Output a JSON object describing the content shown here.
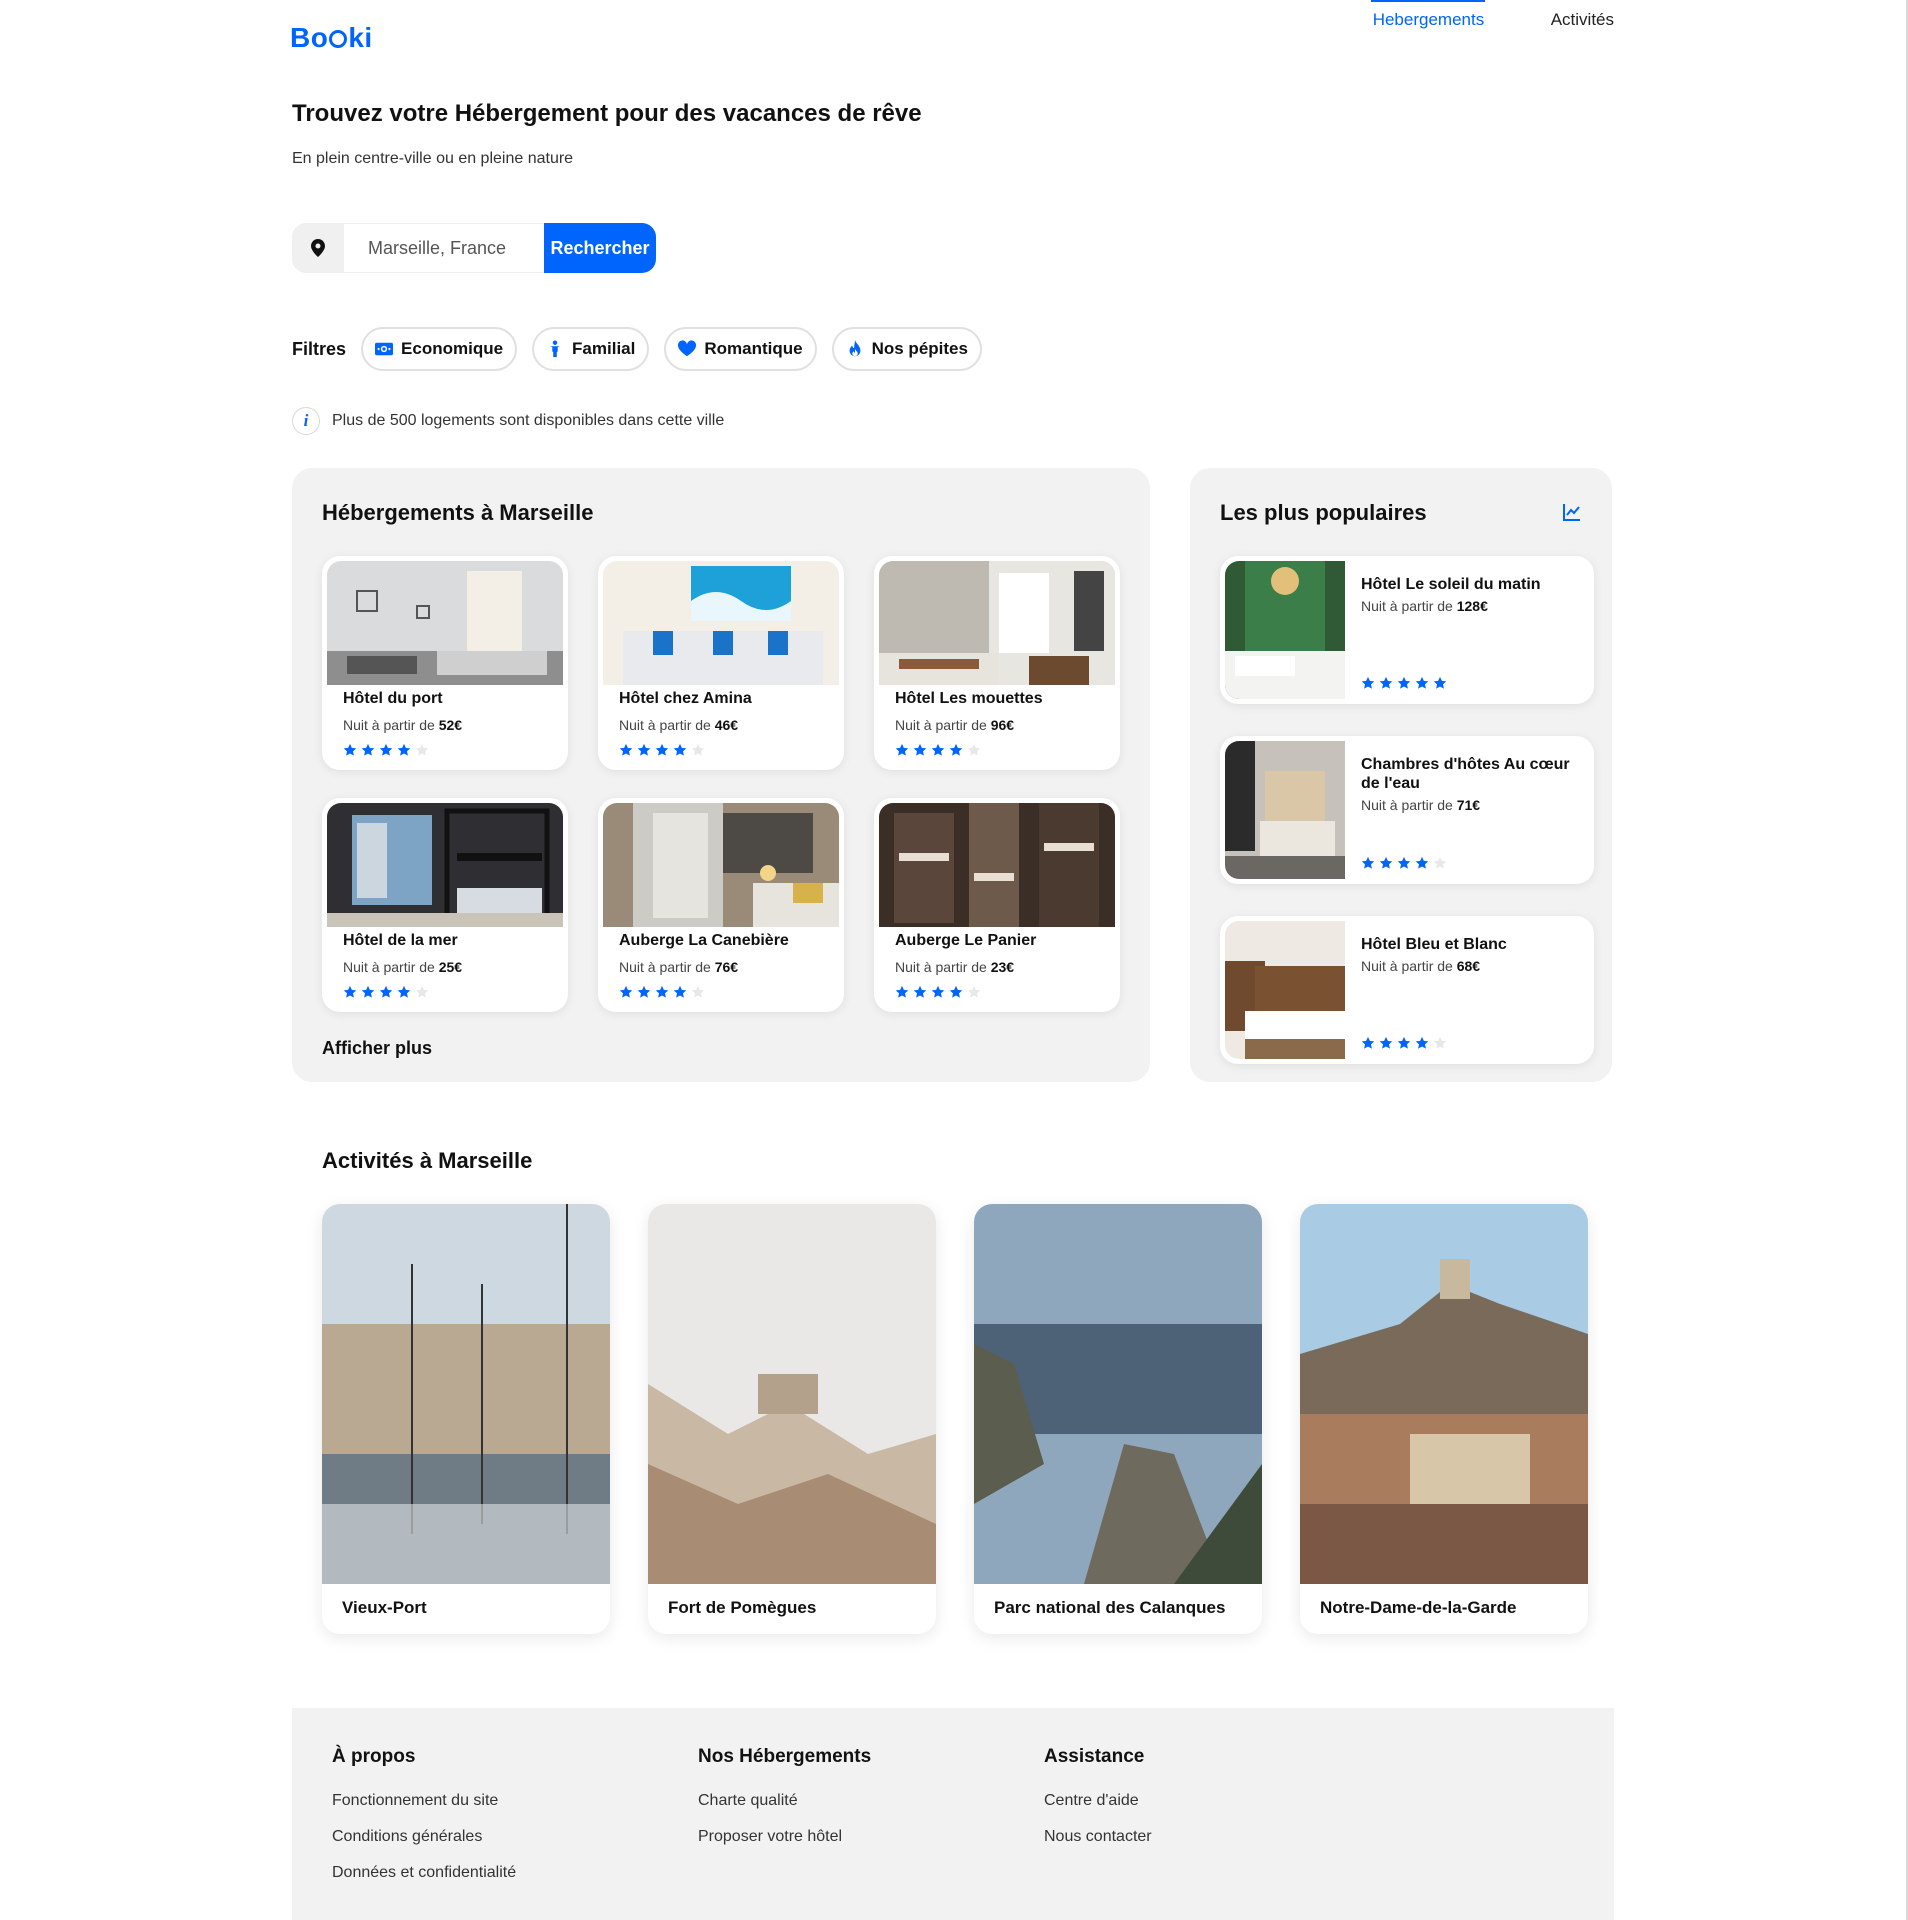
{
  "header": {
    "logo_prefix": "Bo",
    "logo_suffix": "ki",
    "nav": [
      {
        "label": "Hebergements",
        "active": true
      },
      {
        "label": "Activités",
        "active": false
      }
    ]
  },
  "hero": {
    "title": "Trouvez votre Hébergement pour des vacances de rêve",
    "subtitle": "En plein centre-ville ou en pleine nature"
  },
  "search": {
    "value": "Marseille, France",
    "button_label": "Rechercher"
  },
  "filters": {
    "label": "Filtres",
    "chips": [
      {
        "label": "Economique",
        "icon": "money-icon"
      },
      {
        "label": "Familial",
        "icon": "child-icon"
      },
      {
        "label": "Romantique",
        "icon": "heart-icon"
      },
      {
        "label": "Nos pépites",
        "icon": "fire-icon"
      }
    ]
  },
  "info": {
    "text": "Plus de 500 logements sont disponibles dans cette ville"
  },
  "hebergements": {
    "title": "Hébergements à Marseille",
    "price_prefix": "Nuit à partir de ",
    "hotels": [
      {
        "name": "Hôtel du port",
        "price": "52€",
        "rating": 4
      },
      {
        "name": "Hôtel chez Amina",
        "price": "46€",
        "rating": 4
      },
      {
        "name": "Hôtel Les mouettes",
        "price": "96€",
        "rating": 4
      },
      {
        "name": "Hôtel de la mer",
        "price": "25€",
        "rating": 4
      },
      {
        "name": "Auberge La Canebière",
        "price": "76€",
        "rating": 4
      },
      {
        "name": "Auberge Le Panier",
        "price": "23€",
        "rating": 4
      }
    ],
    "show_more": "Afficher plus"
  },
  "populaires": {
    "title": "Les plus populaires",
    "price_prefix": "Nuit à partir de ",
    "items": [
      {
        "name": "Hôtel Le soleil du matin",
        "price": "128€",
        "rating": 5
      },
      {
        "name": "Chambres d'hôtes Au cœur de l'eau",
        "price": "71€",
        "rating": 4
      },
      {
        "name": "Hôtel Bleu et Blanc",
        "price": "68€",
        "rating": 4
      }
    ]
  },
  "activites": {
    "title": "Activités à Marseille",
    "items": [
      {
        "name": "Vieux-Port"
      },
      {
        "name": "Fort de Pomègues"
      },
      {
        "name": "Parc national des Calanques"
      },
      {
        "name": "Notre-Dame-de-la-Garde"
      }
    ]
  },
  "footer": {
    "columns": [
      {
        "title": "À propos",
        "links": [
          "Fonctionnement du site",
          "Conditions générales",
          "Données et confidentialité"
        ]
      },
      {
        "title": "Nos Hébergements",
        "links": [
          "Charte qualité",
          "Proposer votre hôtel"
        ]
      },
      {
        "title": "Assistance",
        "links": [
          "Centre d'aide",
          "Nous contacter"
        ]
      }
    ]
  },
  "colors": {
    "primary": "#0065FC",
    "panel_bg": "#F2F2F2",
    "star_off": "#E8E8E8"
  }
}
